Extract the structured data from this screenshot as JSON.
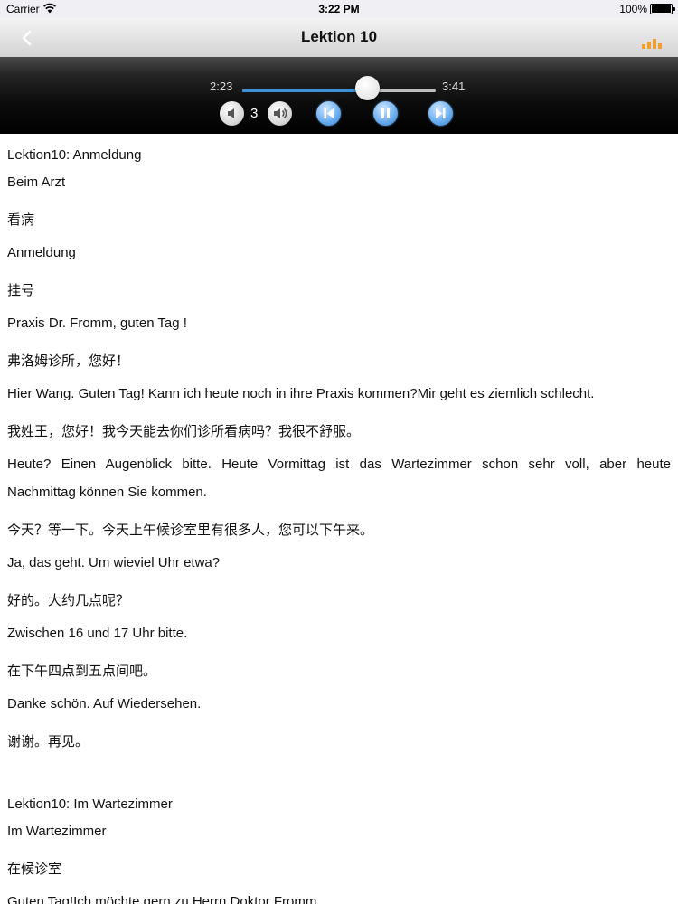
{
  "status_bar": {
    "carrier": "Carrier",
    "time": "3:22 PM",
    "battery": "100%"
  },
  "nav": {
    "title": "Lektion 10",
    "back_icon": "chevron-left-icon",
    "right_icon": "bar-chart-icon",
    "accent_color": "#f0a030"
  },
  "player": {
    "current_time": "2:23",
    "total_time": "3:41",
    "progress": 0.647,
    "volume_level": "3",
    "controls": [
      "volume-down-icon",
      "volume-up-icon",
      "skip-previous-icon",
      "pause-icon",
      "skip-next-icon"
    ],
    "accent_color": "#3d8fd8"
  },
  "content": {
    "lines": [
      "Lektion10: Anmeldung",
      "Beim Arzt",
      "看病",
      "Anmeldung",
      "挂号",
      "Praxis Dr. Fromm, guten Tag !",
      "弗洛姆诊所，您好！",
      "Hier Wang. Guten Tag! Kann ich heute noch in ihre Praxis kommen?Mir geht es ziemlich schlecht.",
      "我姓王，您好！我今天能去你们诊所看病吗？我很不舒服。",
      "Heute? Einen Augenblick bitte. Heute Vormittag ist das Wartezimmer schon sehr voll, aber heute",
      "Nachmittag können Sie kommen.",
      "今天？等一下。今天上午候诊室里有很多人，您可以下午来。",
      "Ja, das geht. Um wieviel Uhr etwa?",
      "好的。大约几点呢？",
      "Zwischen 16 und 17 Uhr bitte.",
      "在下午四点到五点间吧。",
      "Danke schön. Auf Wiedersehen.",
      "谢谢。再见。",
      "Lektion10: Im Wartezimmer",
      "Im Wartezimmer",
      "在候诊室",
      "Guten Tag!Ich möchte gern zu Herrn Doktor Fromm."
    ]
  }
}
